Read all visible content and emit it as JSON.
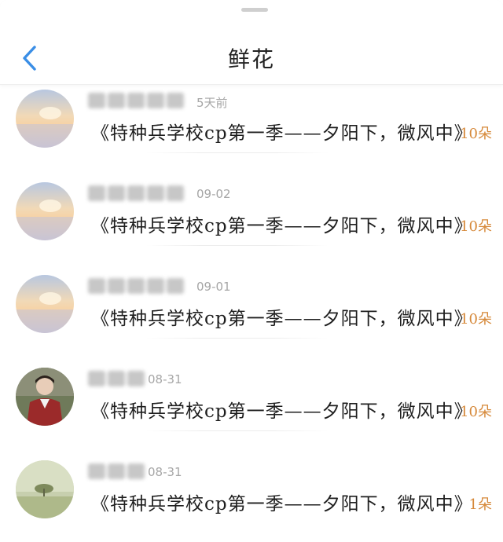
{
  "header": {
    "title": "鲜花"
  },
  "entries": [
    {
      "time": "5天前",
      "message": "《特种兵学校cp第一季——夕阳下，微风中》",
      "count": "10朵",
      "avatar": "sunset-avatar"
    },
    {
      "time": "09-02",
      "message": "《特种兵学校cp第一季——夕阳下，微风中》",
      "count": "10朵",
      "avatar": "sunset-avatar"
    },
    {
      "time": "09-01",
      "message": "《特种兵学校cp第一季——夕阳下，微风中》",
      "count": "10朵",
      "avatar": "sunset-avatar"
    },
    {
      "time": "08-31",
      "message": "《特种兵学校cp第一季——夕阳下，微风中》",
      "count": "10朵",
      "avatar": "person-avatar"
    },
    {
      "time": "08-31",
      "message": "《特种兵学校cp第一季——夕阳下，微风中》",
      "count": "1朵",
      "avatar": "tree-avatar"
    }
  ],
  "colors": {
    "accent": "#d6893a",
    "back": "#3a8ee6"
  }
}
